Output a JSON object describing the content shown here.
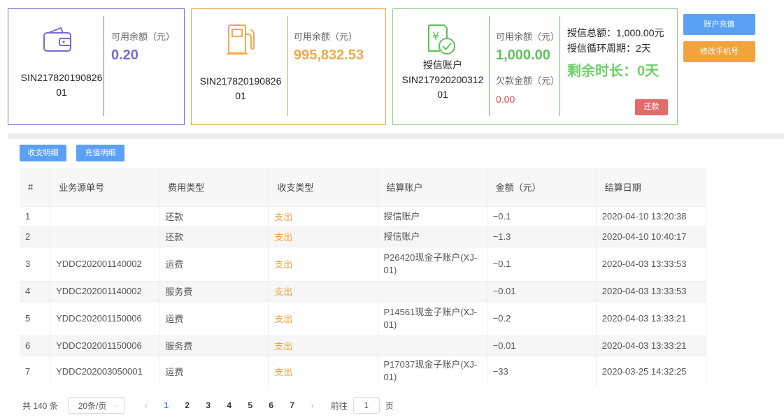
{
  "cards": {
    "wallet": {
      "balance_label": "可用余额（元）",
      "balance_value": "0.20",
      "id_line1": "SIN217820190826",
      "id_line2": "01",
      "color": "#7b68d9"
    },
    "fuel": {
      "balance_label": "可用余额（元）",
      "balance_value": "995,832.53",
      "id_line1": "SIN217820190826",
      "id_line2": "01",
      "color": "#f0a94a"
    },
    "credit": {
      "name": "授信账户",
      "id_line1": "SIN217920200312",
      "id_line2": "01",
      "balance_label": "可用余额（元）",
      "balance_value": "1,000.00",
      "debt_label": "欠款金额（元）",
      "debt_value": "0.00",
      "total_label": "授信总额：1,000.00元",
      "cycle_label": "授信循环周期：2天",
      "remaining_label": "剩余时长：0天",
      "repay_button": "还款",
      "color": "#5ec25a"
    }
  },
  "actions": {
    "recharge_button": "账户充值",
    "change_phone_button": "修改手机号"
  },
  "tabs": {
    "income_expense": "收支明细",
    "recharge": "充值明细"
  },
  "table": {
    "headers": [
      "#",
      "业务源单号",
      "费用类型",
      "收支类型",
      "结算账户",
      "金额（元）",
      "结算日期"
    ],
    "rows": [
      {
        "no": "1",
        "source": "",
        "fee_type": "还款",
        "io_type": "支出",
        "account": "授信账户",
        "amount": "−0.1",
        "date": "2020-04-10 13:20:38"
      },
      {
        "no": "2",
        "source": "",
        "fee_type": "还款",
        "io_type": "支出",
        "account": "授信账户",
        "amount": "−1.3",
        "date": "2020-04-10 10:40:17"
      },
      {
        "no": "3",
        "source": "YDDC202001140002",
        "fee_type": "运费",
        "io_type": "支出",
        "account": "P26420现金子账户(XJ-01)",
        "amount": "−0.1",
        "date": "2020-04-03 13:33:53"
      },
      {
        "no": "4",
        "source": "YDDC202001140002",
        "fee_type": "服务费",
        "io_type": "支出",
        "account": "",
        "amount": "−0.01",
        "date": "2020-04-03 13:33:53"
      },
      {
        "no": "5",
        "source": "YDDC202001150006",
        "fee_type": "运费",
        "io_type": "支出",
        "account": "P14561现金子账户(XJ-01)",
        "amount": "−0.2",
        "date": "2020-04-03 13:33:21"
      },
      {
        "no": "6",
        "source": "YDDC202001150006",
        "fee_type": "服务费",
        "io_type": "支出",
        "account": "",
        "amount": "−0.01",
        "date": "2020-04-03 13:33:21"
      },
      {
        "no": "7",
        "source": "YDDC202003050001",
        "fee_type": "运费",
        "io_type": "支出",
        "account": "P17037现金子账户(XJ-01)",
        "amount": "−33",
        "date": "2020-03-25 14:32:25"
      }
    ]
  },
  "pagination": {
    "total": "共 140 条",
    "page_size": "20条/页",
    "pages": [
      "1",
      "2",
      "3",
      "4",
      "5",
      "6",
      "7"
    ],
    "current": "1",
    "goto_label": "前往",
    "goto_value": "1",
    "page_suffix": "页"
  }
}
